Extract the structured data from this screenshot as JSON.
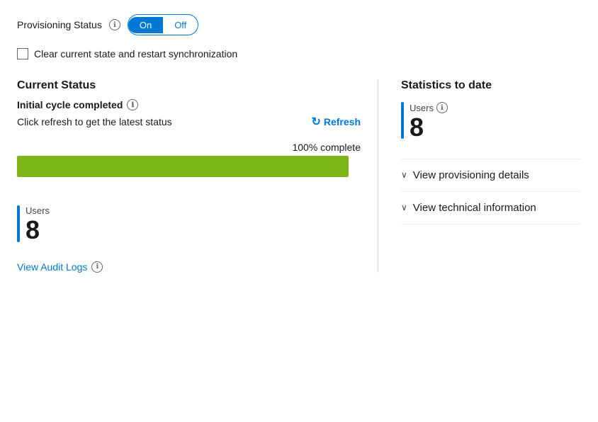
{
  "header": {
    "provisioning_status_label": "Provisioning Status",
    "toggle_on": "On",
    "toggle_off": "Off"
  },
  "checkbox": {
    "label": "Clear current state and restart synchronization",
    "checked": false
  },
  "current_status": {
    "section_title": "Current Status",
    "status_label": "Initial cycle completed",
    "refresh_hint": "Click refresh to get the latest status",
    "refresh_button": "Refresh",
    "progress_label": "100% complete",
    "progress_percent": 100
  },
  "users_left": {
    "label": "Users",
    "count": "8"
  },
  "audit_link": {
    "text": "View Audit Logs"
  },
  "statistics": {
    "section_title": "Statistics to date",
    "users_label": "Users",
    "users_count": "8",
    "view_provisioning": "View provisioning details",
    "view_technical": "View technical information"
  },
  "icons": {
    "info": "ℹ",
    "refresh": "↻",
    "chevron_down": "∨"
  },
  "colors": {
    "accent_blue": "#0078d4",
    "progress_green": "#7cb518",
    "toggle_bg": "#0078d4"
  }
}
